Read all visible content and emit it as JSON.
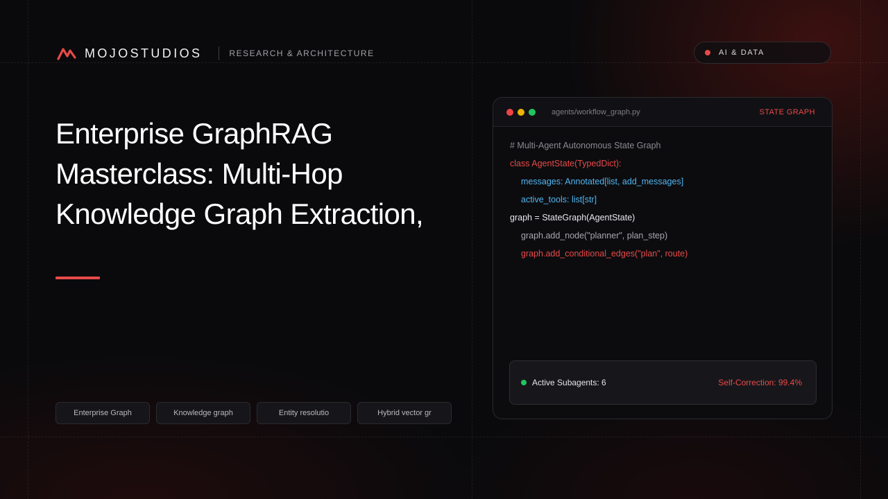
{
  "brand": {
    "name": "MOJOSTUDIOS",
    "section": "RESEARCH & ARCHITECTURE"
  },
  "category": {
    "label": "AI & DATA"
  },
  "title": {
    "line1": "Enterprise GraphRAG",
    "line2": "Masterclass: Multi-Hop",
    "line3": "Knowledge Graph Extraction,"
  },
  "tags": [
    {
      "label": "Enterprise Graph"
    },
    {
      "label": "Knowledge graph"
    },
    {
      "label": "Entity resolutio"
    },
    {
      "label": "Hybrid vector gr"
    }
  ],
  "code_window": {
    "file_path": "agents/workflow_graph.py",
    "badge": "STATE GRAPH",
    "lines": [
      {
        "text": "# Multi-Agent Autonomous State Graph"
      },
      {
        "text": "class AgentState(TypedDict):"
      },
      {
        "text": "messages: Annotated[list, add_messages]"
      },
      {
        "text": "active_tools: list[str]"
      },
      {
        "text": "graph = StateGraph(AgentState)"
      },
      {
        "text": "graph.add_node(\"planner\", plan_step)"
      },
      {
        "text": "graph.add_conditional_edges(\"plan\", route)"
      }
    ],
    "status": {
      "left": "Active Subagents: 6",
      "right": "Self-Correction: 99.4%"
    }
  },
  "colors": {
    "accent": "#e84a47",
    "code_blue": "#52b5ee",
    "status_green": "#22c55e",
    "background": "#0a0a0c"
  }
}
